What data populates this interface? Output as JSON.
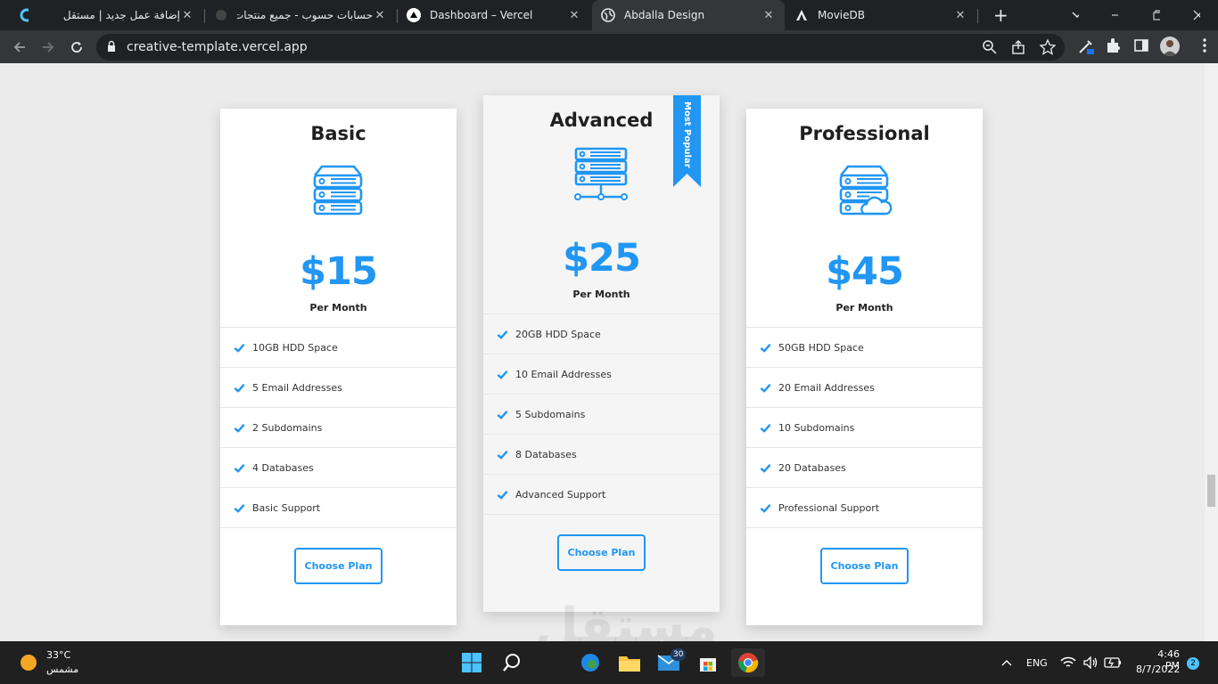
{
  "browser": {
    "tabs": [
      {
        "title": "إضافة عمل جديد | مستقل",
        "icon": "mostaql-icon"
      },
      {
        "title": "حسابات حسوب - جميع منتجات",
        "icon": "hsoub-icon"
      },
      {
        "title": "Dashboard – Vercel",
        "icon": "vercel-icon"
      },
      {
        "title": "Abdalla Design",
        "icon": "globe-icon",
        "active": true
      },
      {
        "title": "MovieDB",
        "icon": "angular-icon"
      }
    ],
    "url": "creative-template.vercel.app"
  },
  "plans": [
    {
      "name": "Basic",
      "icon": "server-stack-icon",
      "price": "$15",
      "period": "Per Month",
      "features": [
        "10GB HDD Space",
        "5 Email Addresses",
        "2 Subdomains",
        "4 Databases",
        "Basic Support"
      ],
      "button": "Choose Plan"
    },
    {
      "name": "Advanced",
      "icon": "server-network-icon",
      "price": "$25",
      "period": "Per Month",
      "ribbon": "Most Popular",
      "features": [
        "20GB HDD Space",
        "10 Email Addresses",
        "5 Subdomains",
        "8 Databases",
        "Advanced Support"
      ],
      "button": "Choose Plan"
    },
    {
      "name": "Professional",
      "icon": "server-cloud-icon",
      "price": "$45",
      "period": "Per Month",
      "features": [
        "50GB HDD Space",
        "20 Email Addresses",
        "10 Subdomains",
        "20 Databases",
        "Professional Support"
      ],
      "button": "Choose Plan"
    }
  ],
  "watermark": "مستقل",
  "taskbar": {
    "weather_temp": "33°C",
    "weather_cond": "مشمس",
    "lang": "ENG",
    "time": "4:46 PM",
    "date": "8/7/2022",
    "mail_badge": "30",
    "notif_badge": "2"
  },
  "colors": {
    "accent": "#2196f3",
    "tabbar": "#202124",
    "toolbar": "#35363a",
    "taskbar": "#202020"
  }
}
